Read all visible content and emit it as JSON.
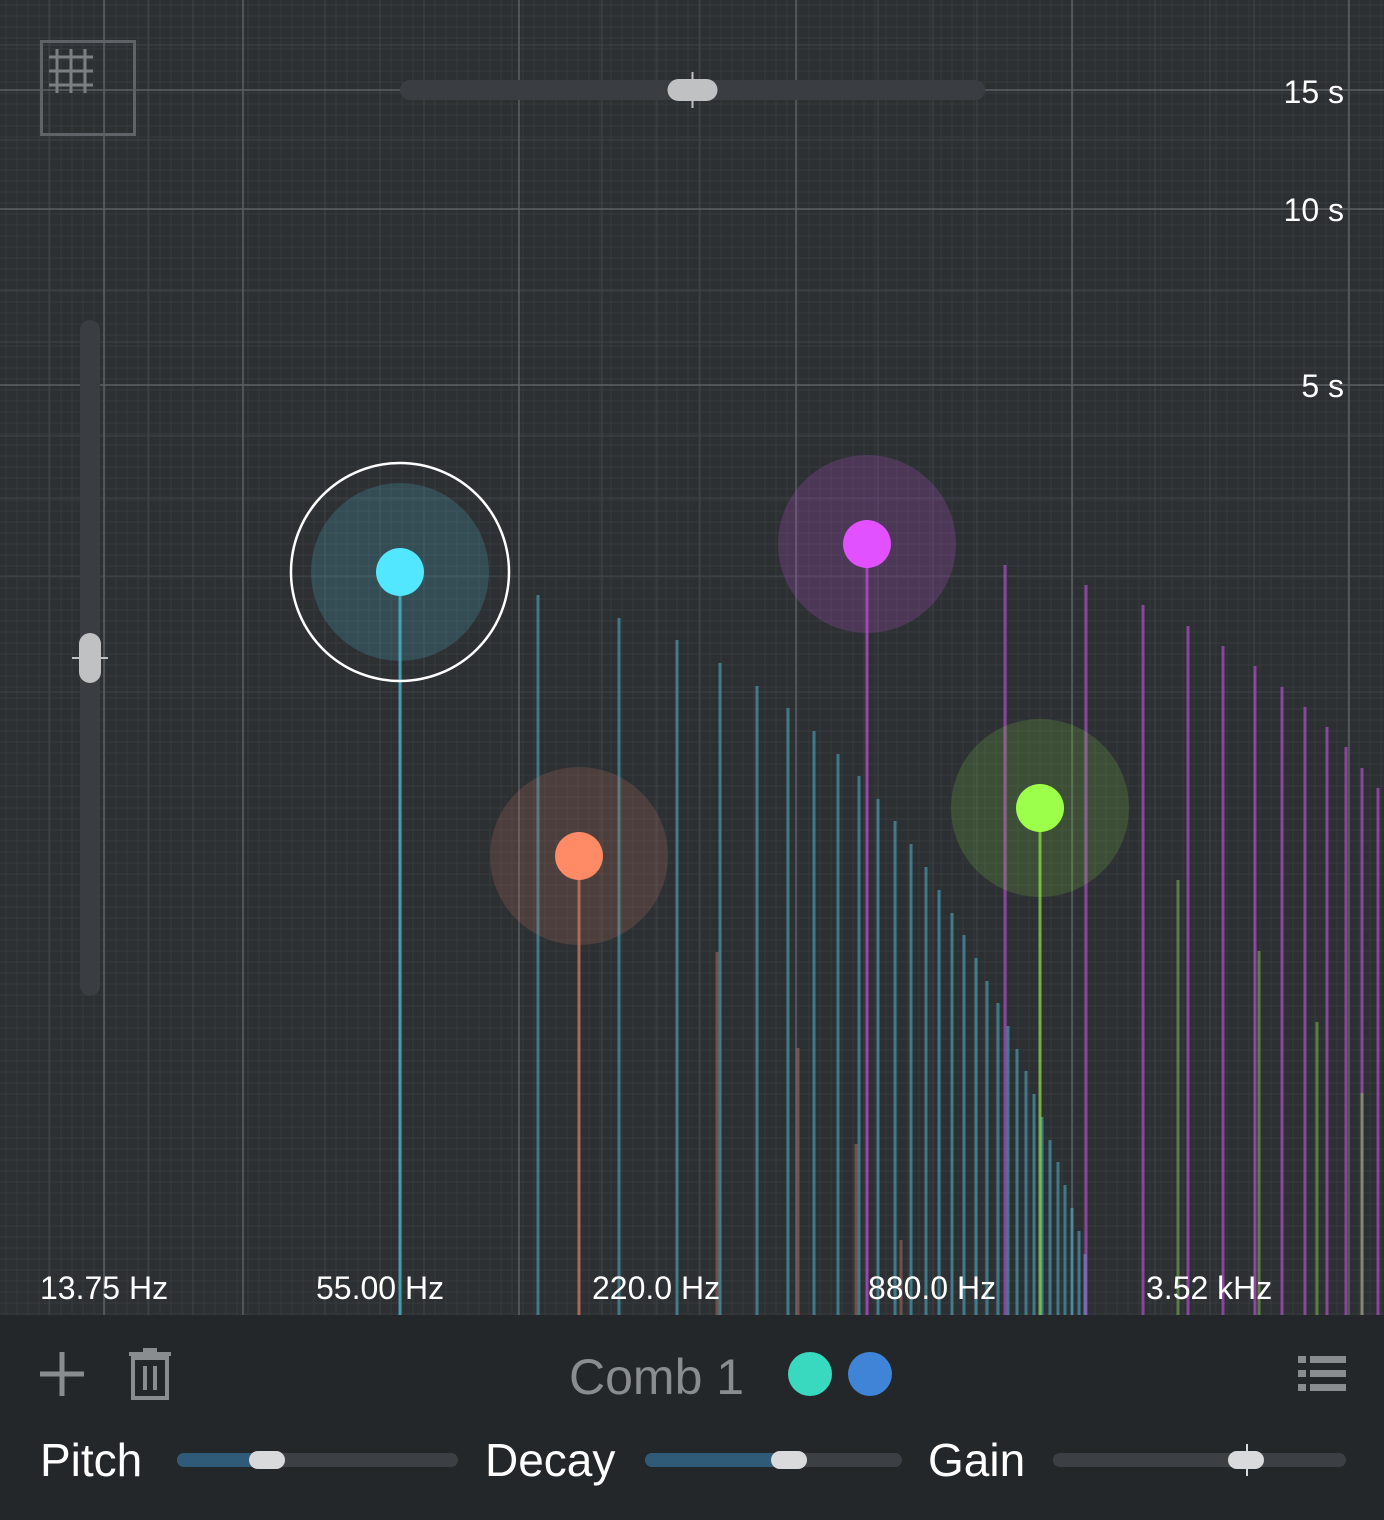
{
  "frequency_axis": {
    "labels": [
      "13.75 Hz",
      "55.00 Hz",
      "220.0 Hz",
      "880.0 Hz",
      "3.52 kHz"
    ]
  },
  "time_axis": {
    "labels": [
      "15 s",
      "10 s",
      "5 s"
    ]
  },
  "nodes": [
    {
      "name": "cyan",
      "color": "#52e6ff",
      "selected": true
    },
    {
      "name": "orange",
      "color": "#ff8a66",
      "selected": false
    },
    {
      "name": "magenta",
      "color": "#e251ff",
      "selected": false
    },
    {
      "name": "lime",
      "color": "#9cff4a",
      "selected": false
    }
  ],
  "zoom": {
    "horizontal_value": 0.5,
    "vertical_value": 0.5
  },
  "panel": {
    "title": "Comb 1",
    "add_icon": "plus-icon",
    "delete_icon": "trash-icon",
    "list_icon": "list-icon",
    "color_dots": [
      "#38d9bf",
      "#3f84d6"
    ],
    "params": [
      {
        "label": "Pitch",
        "value": 0.32
      },
      {
        "label": "Decay",
        "value": 0.56
      },
      {
        "label": "Gain",
        "value": 0.66
      }
    ]
  },
  "colors": {
    "accent": "#2f5b79",
    "background": "#2d3033",
    "panel": "#23272a"
  }
}
